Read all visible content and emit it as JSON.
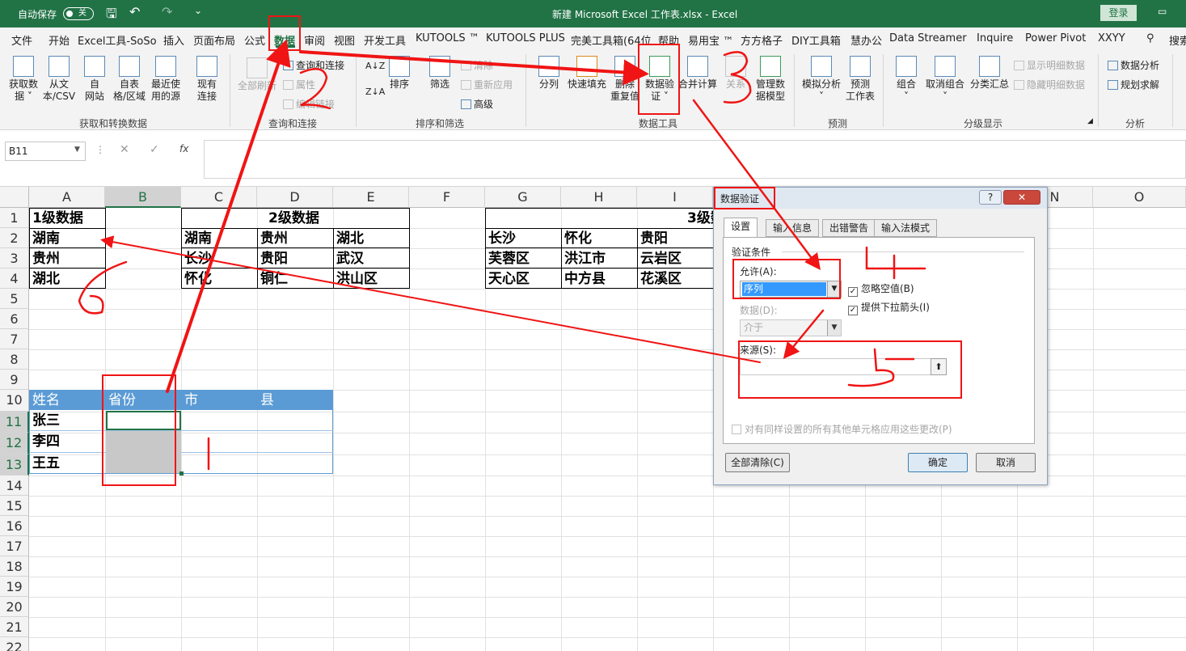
{
  "titlebar": {
    "autosave_label": "自动保存",
    "autosave_state": "关",
    "doc_title": "新建 Microsoft Excel 工作表.xlsx  -  Excel",
    "login_label": "登录",
    "bg_color": "#217346"
  },
  "tabs": [
    "文件",
    "开始",
    "Excel工具-SoSo",
    "插入",
    "页面布局",
    "公式",
    "数据",
    "审阅",
    "视图",
    "开发工具",
    "KUTOOLS ™",
    "KUTOOLS PLUS",
    "完美工具箱(64位",
    "帮助",
    "易用宝 ™",
    "方方格子",
    "DIY工具箱",
    "慧办公",
    "Data Streamer",
    "Inquire",
    "Power Pivot",
    "XXYY",
    "搜索"
  ],
  "ribbon": {
    "get_transform": {
      "group_label": "获取和转换数据",
      "buttons": [
        {
          "line1": "获取数",
          "line2": "据 ˅"
        },
        {
          "line1": "从文",
          "line2": "本/CSV"
        },
        {
          "line1": "自",
          "line2": "网站"
        },
        {
          "line1": "自表",
          "line2": "格/区域"
        },
        {
          "line1": "最近使",
          "line2": "用的源"
        },
        {
          "line1": "现有",
          "line2": "连接"
        }
      ]
    },
    "query": {
      "group_label": "查询和连接",
      "refresh_all": "全部刷新",
      "items": [
        "查询和连接",
        "属性",
        "编辑链接"
      ]
    },
    "sort_filter": {
      "group_label": "排序和筛选",
      "sort": "排序",
      "filter": "筛选",
      "items": [
        "清除",
        "重新应用",
        "高级"
      ]
    },
    "data_tools": {
      "group_label": "数据工具",
      "buttons": [
        {
          "line1": "分列",
          "line2": ""
        },
        {
          "line1": "快速填充",
          "line2": ""
        },
        {
          "line1": "删除",
          "line2": "重复值"
        },
        {
          "line1": "数据验",
          "line2": "证 ˅"
        },
        {
          "line1": "合并计算",
          "line2": ""
        },
        {
          "line1": "关系",
          "line2": ""
        },
        {
          "line1": "管理数",
          "line2": "据模型"
        }
      ]
    },
    "forecast": {
      "group_label": "预测",
      "buttons": [
        {
          "line1": "模拟分析",
          "line2": "˅"
        },
        {
          "line1": "预测",
          "line2": "工作表"
        }
      ]
    },
    "outline": {
      "group_label": "分级显示",
      "buttons": [
        {
          "line1": "组合",
          "line2": "˅"
        },
        {
          "line1": "取消组合",
          "line2": "˅"
        },
        {
          "line1": "分类汇总",
          "line2": ""
        }
      ],
      "items": [
        "显示明细数据",
        "隐藏明细数据"
      ]
    },
    "analysis": {
      "group_label": "分析",
      "items": [
        "数据分析",
        "规划求解"
      ]
    }
  },
  "formula_bar": {
    "name_box": "B11",
    "fx": "fx",
    "value": ""
  },
  "sheet": {
    "columns": [
      "A",
      "B",
      "C",
      "D",
      "E",
      "F",
      "G",
      "H",
      "I",
      "",
      "",
      "",
      "",
      "N",
      "O"
    ],
    "rows": [
      "1",
      "2",
      "3",
      "4",
      "5",
      "6",
      "7",
      "8",
      "9",
      "10",
      "11",
      "12",
      "13",
      "14",
      "15",
      "16",
      "17",
      "18",
      "19",
      "20",
      "21",
      "22"
    ],
    "level1": {
      "header": "1级数据",
      "items": [
        "湖南",
        "贵州",
        "湖北"
      ]
    },
    "level2": {
      "header": "2级数据",
      "rows": [
        [
          "湖南",
          "贵州",
          "湖北"
        ],
        [
          "长沙",
          "贵阳",
          "武汉"
        ],
        [
          "怀化",
          "铜仁",
          "洪山区"
        ]
      ]
    },
    "level3": {
      "header": "3级数",
      "rows": [
        [
          "长沙",
          "怀化",
          "贵阳"
        ],
        [
          "芙蓉区",
          "洪江市",
          "云岩区"
        ],
        [
          "天心区",
          "中方县",
          "花溪区"
        ]
      ]
    },
    "table": {
      "headers": [
        "姓名",
        "省份",
        "市",
        "县"
      ],
      "rows": [
        [
          "张三",
          "",
          "",
          " "
        ],
        [
          "李四",
          "",
          "",
          " "
        ],
        [
          "王五",
          "",
          "",
          " "
        ]
      ],
      "header_color": "#5b9bd5"
    }
  },
  "dialog": {
    "title": "数据验证",
    "help": "?",
    "tabs": [
      "设置",
      "输入信息",
      "出错警告",
      "输入法模式"
    ],
    "criteria_label": "验证条件",
    "allow_label": "允许(A):",
    "allow_value": "序列",
    "ignore_blank": "忽略空值(B)",
    "dropdown_arrow": "提供下拉箭头(I)",
    "data_label": "数据(D):",
    "data_value": "介于",
    "source_label": "来源(S):",
    "source_value": "",
    "apply_all": "对有同样设置的所有其他单元格应用这些更改(P)",
    "clear_all": "全部清除(C)",
    "ok": "确定",
    "cancel": "取消"
  },
  "colors": {
    "annotation": "#f01414",
    "accent": "#217346"
  }
}
